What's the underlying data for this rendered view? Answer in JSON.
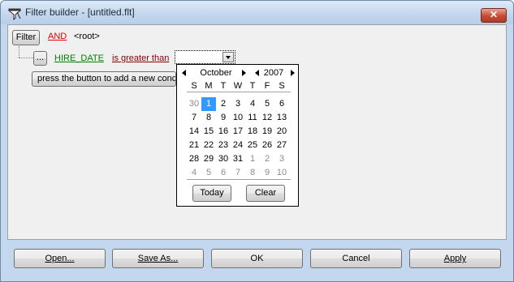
{
  "window": {
    "title": "Filter builder - [untitled.flt]",
    "close_glyph": "✕"
  },
  "filter": {
    "button_label": "Filter",
    "group_operator": "AND",
    "root_label": "<root>",
    "condition": {
      "ellipsis_label": "...",
      "field": "HIRE_DATE",
      "operator": "is greater than",
      "value": ""
    },
    "add_condition_label": "press the button to add a new condition"
  },
  "calendar": {
    "month": "October",
    "year": "2007",
    "weekdays": [
      "S",
      "M",
      "T",
      "W",
      "T",
      "F",
      "S"
    ],
    "weeks": [
      [
        "30",
        "1",
        "2",
        "3",
        "4",
        "5",
        "6"
      ],
      [
        "7",
        "8",
        "9",
        "10",
        "11",
        "12",
        "13"
      ],
      [
        "14",
        "15",
        "16",
        "17",
        "18",
        "19",
        "20"
      ],
      [
        "21",
        "22",
        "23",
        "24",
        "25",
        "26",
        "27"
      ],
      [
        "28",
        "29",
        "30",
        "31",
        "1",
        "2",
        "3"
      ],
      [
        "4",
        "5",
        "6",
        "7",
        "8",
        "9",
        "10"
      ]
    ],
    "selected_day": "1",
    "today_label": "Today",
    "clear_label": "Clear"
  },
  "buttons": {
    "open": "Open...",
    "save_as": "Save As...",
    "ok": "OK",
    "cancel": "Cancel",
    "apply": "Apply"
  },
  "icons": {
    "app": "filter-funnel-icon",
    "close": "close-icon"
  },
  "colors": {
    "operator_and": "#e00000",
    "field": "#008000",
    "comparison": "#800000",
    "selected_day": "#3399ff"
  }
}
